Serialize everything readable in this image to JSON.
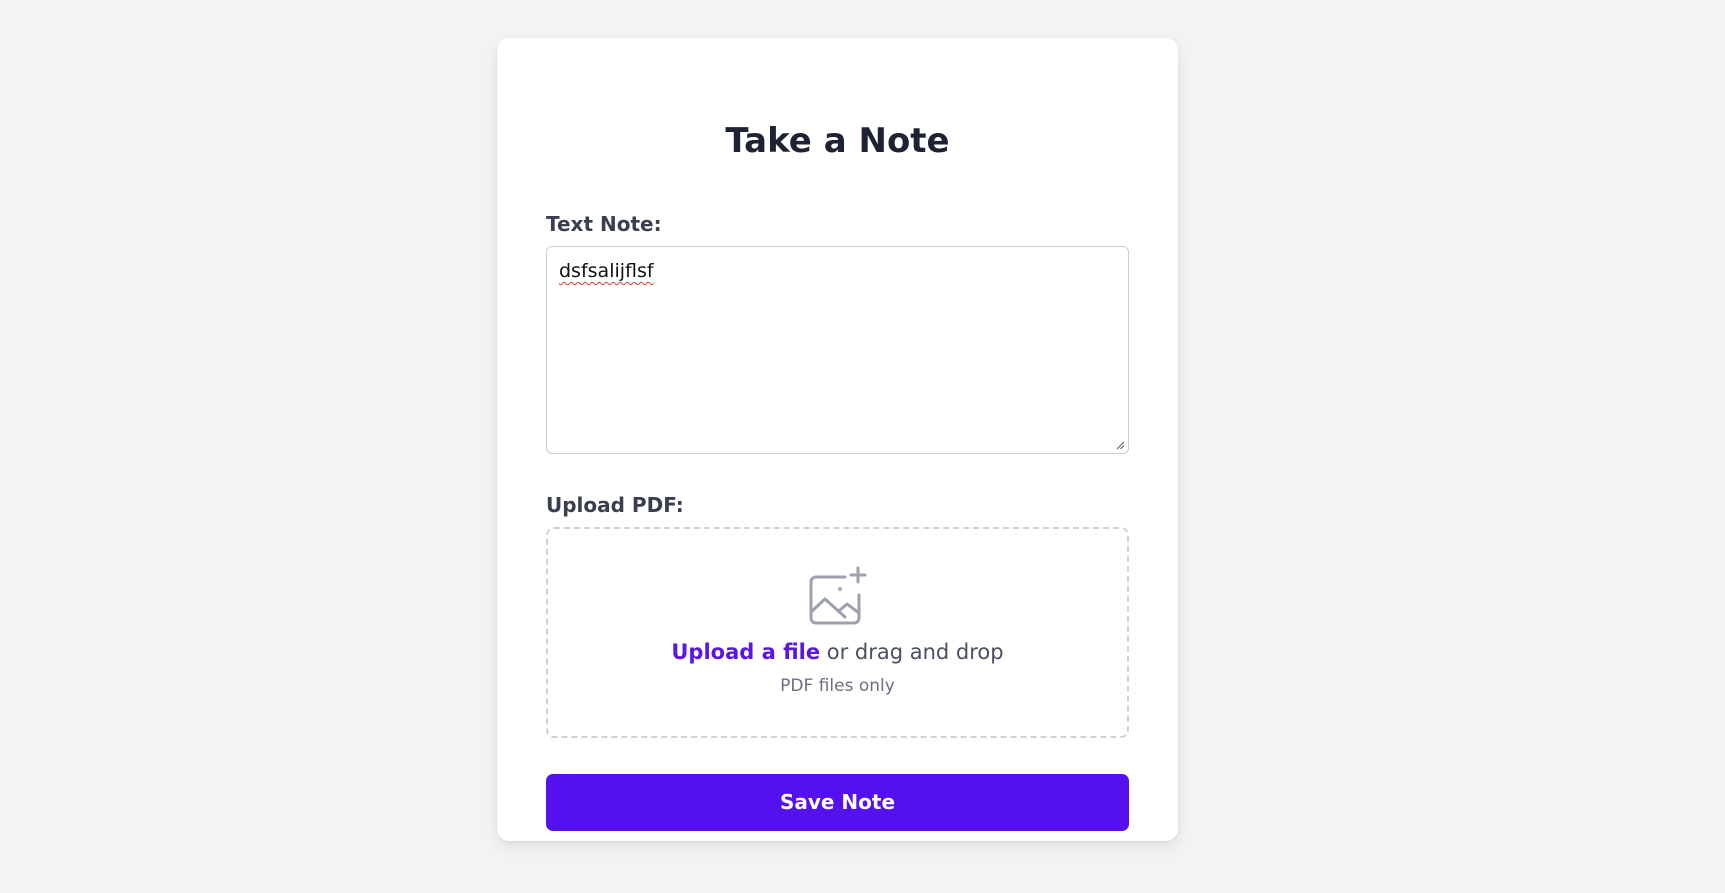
{
  "form": {
    "title": "Take a Note",
    "text_note_label": "Text Note:",
    "text_note_value": "dsfsalijflsf",
    "upload_label": "Upload PDF:",
    "dropzone": {
      "icon": "image-add-icon",
      "link_text": "Upload a file",
      "rest_text": " or drag and drop",
      "hint": "PDF files only"
    },
    "save_label": "Save Note"
  },
  "colors": {
    "background": "#f2f3f5",
    "card": "#ffffff",
    "accent": "#5510ee",
    "link": "#5a16e8",
    "heading": "#1f2233"
  }
}
